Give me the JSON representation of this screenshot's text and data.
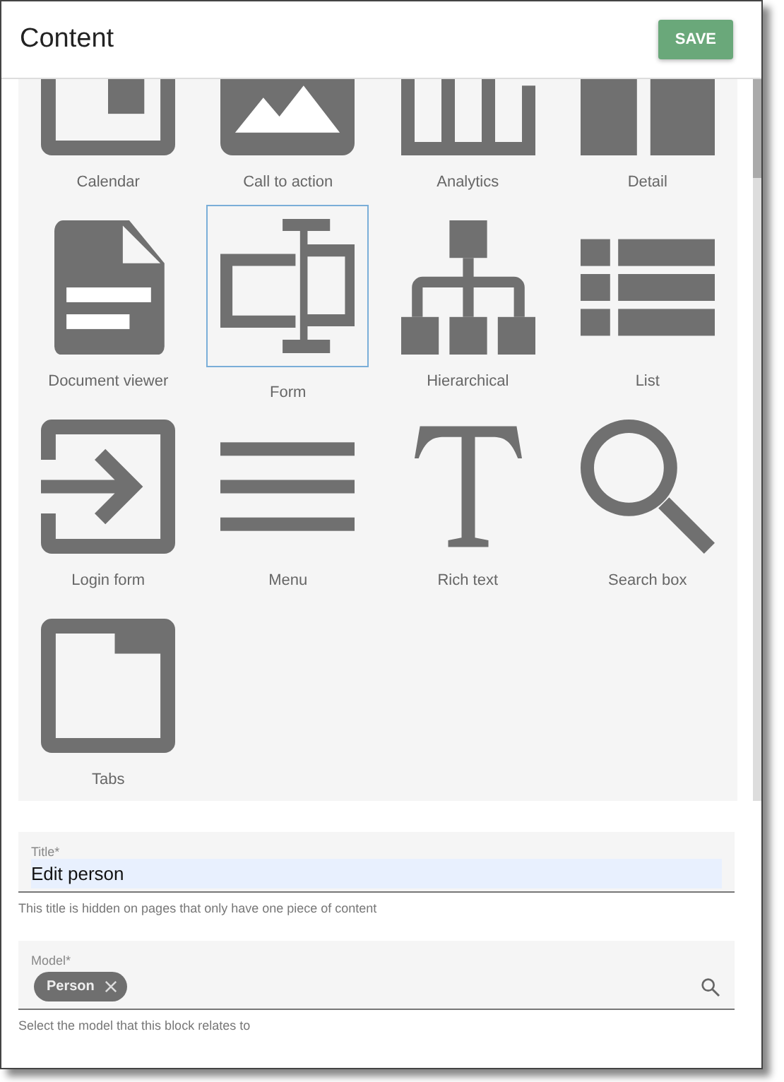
{
  "header": {
    "title": "Content",
    "save_button": "SAVE"
  },
  "blocks": [
    {
      "label": "Calendar",
      "kind": "calendar",
      "selected": false
    },
    {
      "label": "Call to action",
      "kind": "picture-card",
      "selected": false
    },
    {
      "label": "Analytics",
      "kind": "bars",
      "selected": false
    },
    {
      "label": "Detail",
      "kind": "detail",
      "selected": false
    },
    {
      "label": "Document viewer",
      "kind": "document",
      "selected": false
    },
    {
      "label": "Form",
      "kind": "form",
      "selected": true
    },
    {
      "label": "Hierarchical",
      "kind": "hierarchy",
      "selected": false
    },
    {
      "label": "List",
      "kind": "list",
      "selected": false
    },
    {
      "label": "Login form",
      "kind": "login",
      "selected": false
    },
    {
      "label": "Menu",
      "kind": "menu",
      "selected": false
    },
    {
      "label": "Rich text",
      "kind": "text",
      "selected": false
    },
    {
      "label": "Search box",
      "kind": "search",
      "selected": false
    },
    {
      "label": "Tabs",
      "kind": "tabs",
      "selected": false
    }
  ],
  "fields": [
    {
      "kind": "text",
      "label": "Title*",
      "value": "Edit person",
      "autofilled": true,
      "helper": "This title is hidden on pages that only have one piece of content"
    },
    {
      "kind": "lookup",
      "label": "Model*",
      "chips": [
        "Person"
      ],
      "helper": "Select the model that this block relates to"
    }
  ]
}
